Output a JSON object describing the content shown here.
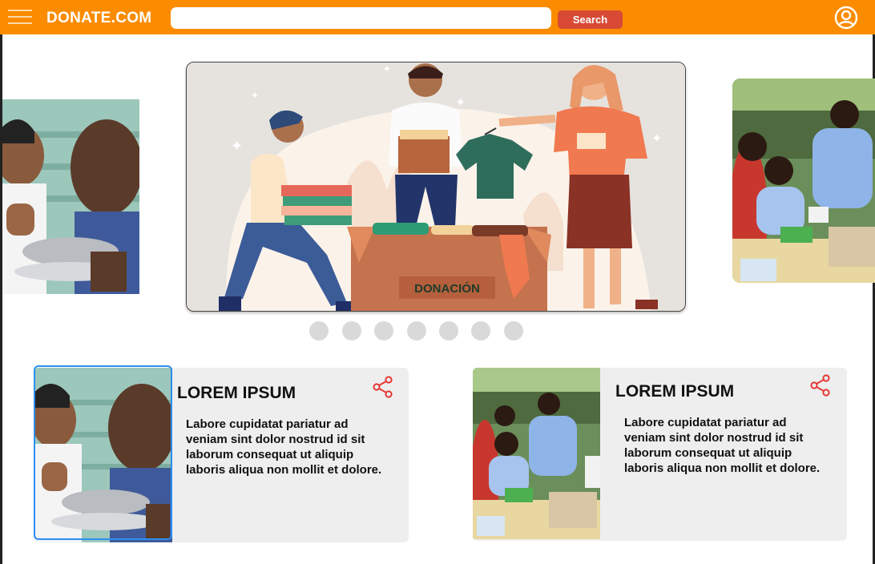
{
  "header": {
    "logo": "DONATE.COM",
    "search_placeholder": "",
    "search_button": "Search",
    "menu_icon": "hamburger-menu-icon",
    "user_icon": "user-circle-icon"
  },
  "carousel": {
    "main_image_box_label": "DONACIÓN",
    "slide_count": 7,
    "left_image": "volunteers-eating-photo",
    "right_image": "medical-volunteers-photo"
  },
  "cards": [
    {
      "title": "LOREM IPSUM",
      "lines": [
        "Labore cupidatat pariatur ad",
        "veniam sint dolor nostrud id sit",
        "laborum consequat ut aliquip",
        "laboris aliqua non mollit et dolore."
      ],
      "share_icon": "share-icon",
      "image": "volunteers-eating-photo"
    },
    {
      "title": "LOREM IPSUM",
      "lines": [
        "Labore cupidatat pariatur ad",
        "veniam sint dolor nostrud id sit",
        "laborum consequat ut aliquip",
        "laboris aliqua non mollit et dolore."
      ],
      "share_icon": "share-icon",
      "image": "medical-volunteers-photo"
    }
  ],
  "colors": {
    "header": "#fb8c00",
    "search_button": "#d84a35",
    "share_icon": "#e53935",
    "card_bg": "#eeeeee",
    "dot": "#d9d9d9",
    "selection": "#2d8ef0"
  }
}
